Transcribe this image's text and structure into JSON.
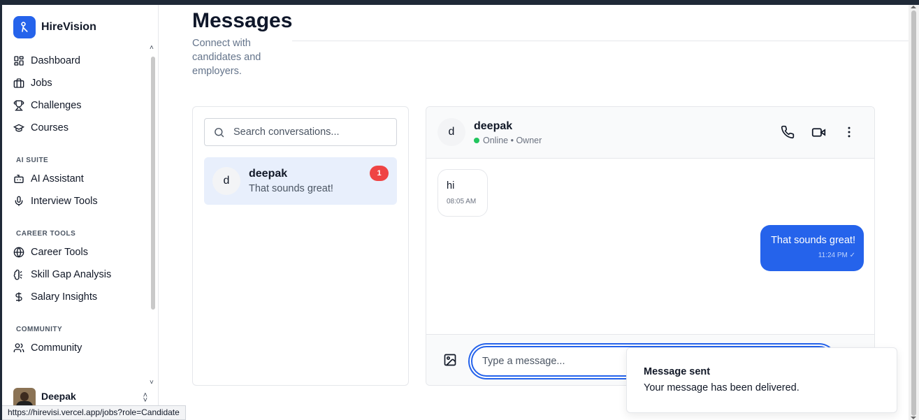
{
  "brand": {
    "name": "HireVision"
  },
  "sidebar": {
    "items": [
      {
        "label": "Dashboard",
        "icon": "dashboard-icon"
      },
      {
        "label": "Jobs",
        "icon": "briefcase-icon"
      },
      {
        "label": "Challenges",
        "icon": "trophy-icon"
      },
      {
        "label": "Courses",
        "icon": "graduation-cap-icon"
      }
    ],
    "sections": [
      {
        "title": "AI SUITE",
        "items": [
          {
            "label": "AI Assistant",
            "icon": "bot-icon"
          },
          {
            "label": "Interview Tools",
            "icon": "mic-icon"
          }
        ]
      },
      {
        "title": "CAREER TOOLS",
        "items": [
          {
            "label": "Career Tools",
            "icon": "globe-icon"
          },
          {
            "label": "Skill Gap Analysis",
            "icon": "brain-icon"
          },
          {
            "label": "Salary Insights",
            "icon": "dollar-icon"
          }
        ]
      },
      {
        "title": "COMMUNITY",
        "items": [
          {
            "label": "Community",
            "icon": "users-icon"
          }
        ]
      }
    ],
    "user": {
      "name": "Deepak"
    }
  },
  "page": {
    "title": "Messages",
    "subtitle": "Connect with candidates and employers."
  },
  "conversations": {
    "search_placeholder": "Search conversations...",
    "items": [
      {
        "initial": "d",
        "name": "deepak",
        "preview": "That sounds great!",
        "unread": "1"
      }
    ]
  },
  "chat": {
    "contact": {
      "initial": "d",
      "name": "deepak",
      "status": "Online",
      "role": "Owner",
      "status_line": "Online • Owner"
    },
    "messages": [
      {
        "direction": "in",
        "text": "hi",
        "time": "08:05 AM"
      },
      {
        "direction": "out",
        "text": "That sounds great!",
        "time": "11:24 PM ✓"
      }
    ],
    "input_placeholder": "Type a message..."
  },
  "toast": {
    "title": "Message sent",
    "description": "Your message has been delivered."
  },
  "status_bar": {
    "url": "https://hirevisi.vercel.app/jobs?role=Candidate"
  },
  "colors": {
    "accent": "#2563eb",
    "badge": "#ef4444",
    "online": "#22c55e"
  }
}
